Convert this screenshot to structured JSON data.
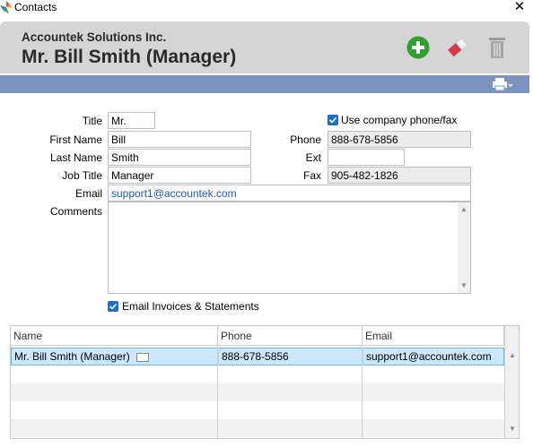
{
  "window": {
    "title": "Contacts",
    "close_label": "✕"
  },
  "header": {
    "company": "Accountek Solutions Inc.",
    "contact_title": "Mr. Bill Smith (Manager)",
    "add_icon": "add-icon",
    "erase_icon": "eraser-icon",
    "delete_icon": "trash-icon",
    "print_icon": "printer-icon"
  },
  "form": {
    "title_label": "Title",
    "title_value": "Mr.",
    "first_name_label": "First Name",
    "first_name_value": "Bill",
    "last_name_label": "Last Name",
    "last_name_value": "Smith",
    "job_title_label": "Job Title",
    "job_title_value": "Manager",
    "email_label": "Email",
    "email_value": "support1@accountek.com",
    "comments_label": "Comments",
    "comments_value": "",
    "use_company_label": "Use company phone/fax",
    "use_company_checked": true,
    "phone_label": "Phone",
    "phone_value": "888-678-5856",
    "ext_label": "Ext",
    "ext_value": "",
    "fax_label": "Fax",
    "fax_value": "905-482-1826",
    "email_invoices_label": "Email Invoices & Statements",
    "email_invoices_checked": true
  },
  "grid": {
    "columns": [
      "Name",
      "Phone",
      "Email"
    ],
    "rows": [
      {
        "name": "Mr. Bill Smith (Manager)",
        "phone": "888-678-5856",
        "email": "support1@accountek.com",
        "selected": true
      }
    ]
  },
  "colors": {
    "accent_band": "#7b93bf",
    "header_bg": "#d5d5d5",
    "selected_row": "#cce8ff",
    "link": "#1a56c9",
    "add_green": "#2ea12e"
  }
}
